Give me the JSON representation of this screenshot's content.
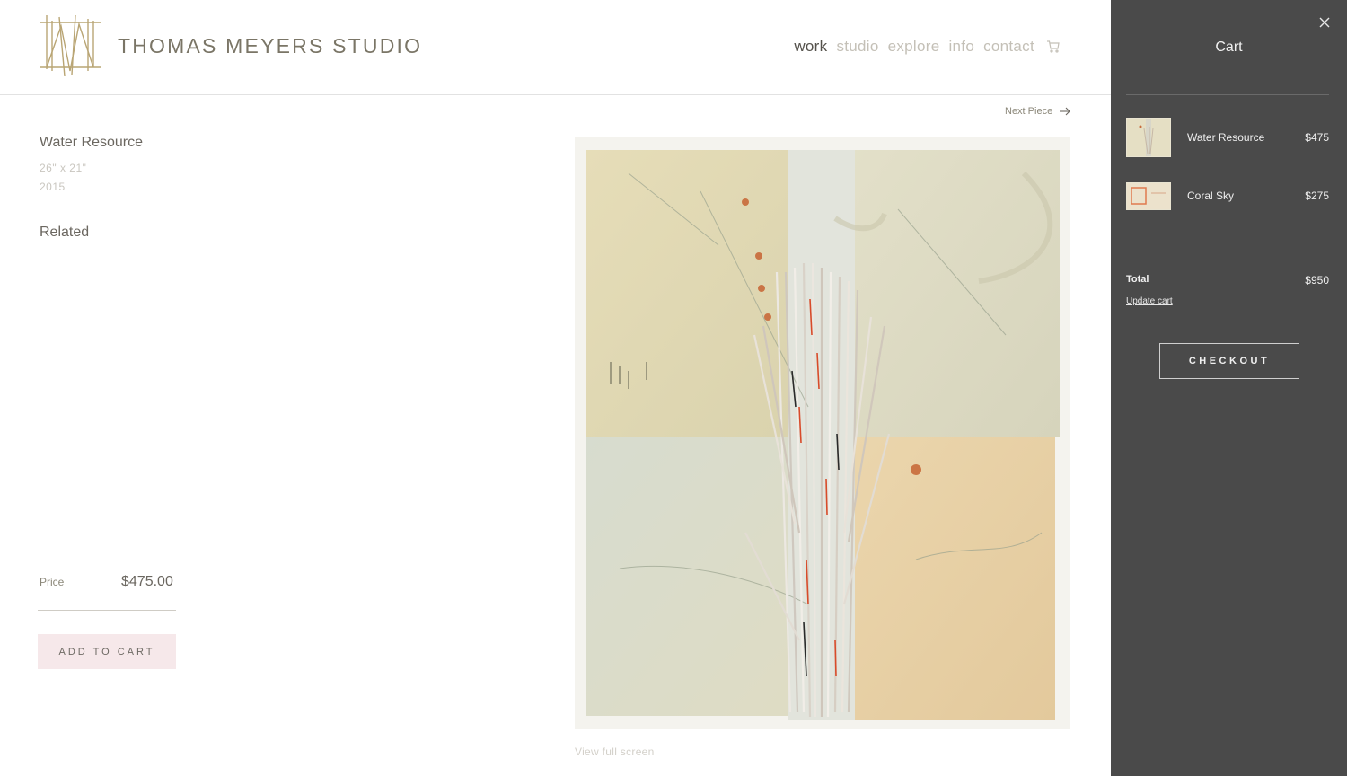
{
  "header": {
    "brand": "THOMAS MEYERS STUDIO",
    "logo_icon": "tm-monogram-logo",
    "nav": [
      {
        "label": "work",
        "active": true
      },
      {
        "label": "studio",
        "active": false
      },
      {
        "label": "explore",
        "active": false
      },
      {
        "label": "info",
        "active": false
      },
      {
        "label": "contact",
        "active": false
      }
    ],
    "cart_icon": "cart-icon"
  },
  "piece": {
    "title": "Water Resource",
    "dimensions": "26\" x 21\"",
    "year": "2015",
    "related_heading": "Related",
    "price_label": "Price",
    "price": "$475.00",
    "add_to_cart": "ADD TO CART",
    "next_piece": "Next Piece",
    "view_full_screen": "View full screen"
  },
  "cart": {
    "title": "Cart",
    "items": [
      {
        "name": "Water Resource",
        "price": "$475"
      },
      {
        "name": "Coral Sky",
        "price": "$275"
      }
    ],
    "total_label": "Total",
    "total_value": "$950",
    "update_cart": "Update cart",
    "checkout": "CHECKOUT"
  },
  "colors": {
    "brand_gold": "#b9a574",
    "cart_panel": "#4a4a4a",
    "add_button_bg": "#f6e8ea"
  }
}
